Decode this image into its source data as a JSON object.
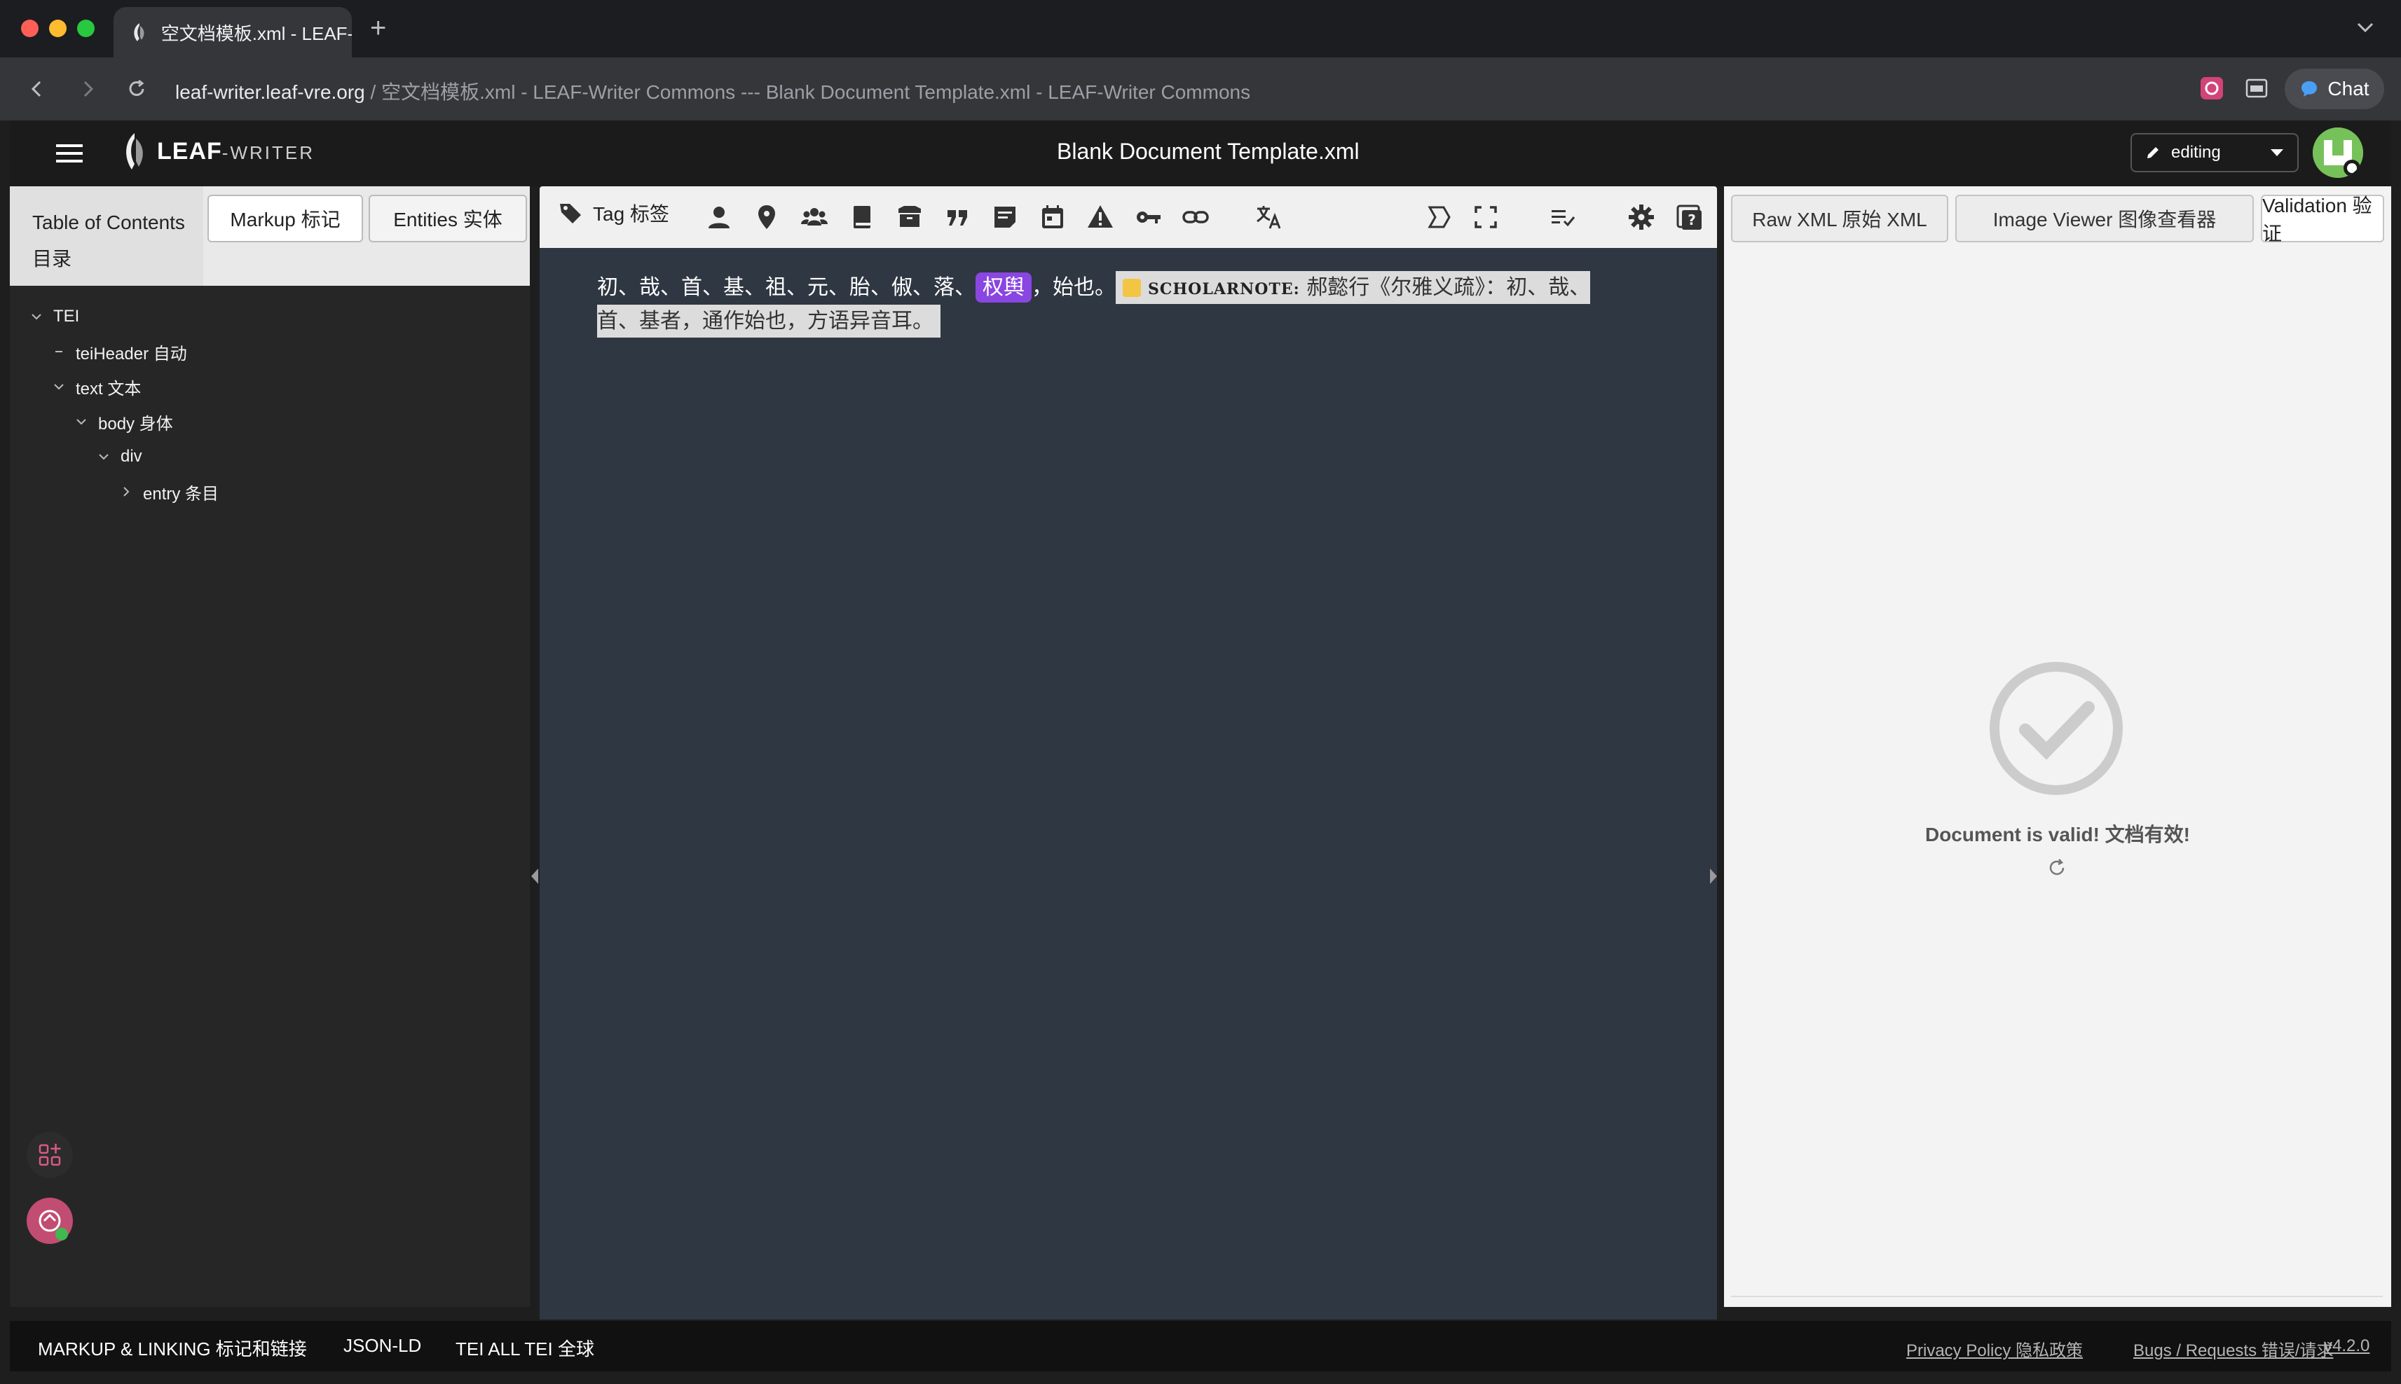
{
  "browser": {
    "tab_title": "空文档模板.xml - LEAF-",
    "new_tab": "+",
    "url_host": "leaf-writer.leaf-vre.org",
    "url_rest": " / 空文档模板.xml - LEAF-Writer Commons --- Blank Document Template.xml - LEAF-Writer Commons",
    "chat_label": "Chat"
  },
  "header": {
    "logo_main": "LEAF",
    "logo_sub": "-WRITER",
    "doc_title": "Blank Document Template.xml",
    "mode": "editing"
  },
  "left_panel": {
    "tabs": {
      "toc": "Table of Contents 目录",
      "markup": "Markup 标记",
      "entities": "Entities 实体"
    },
    "tree": [
      {
        "label": "TEI"
      },
      {
        "label": "teiHeader 自动"
      },
      {
        "label": "text 文本"
      },
      {
        "label": "body 身体"
      },
      {
        "label": "div"
      },
      {
        "label": "entry 条目"
      }
    ]
  },
  "toolbar": {
    "tag_label": "Tag 标签"
  },
  "editor": {
    "text_before": "初、哉、首、基、祖、元、胎、俶、落、",
    "entity": "权舆",
    "text_after": "，始也。",
    "note_label": "SCHOLARNOTE:",
    "note_text": " 郝懿行《尔雅义疏》：初、哉、首、基者，通作始也，方语异音耳。"
  },
  "right_panel": {
    "tabs": {
      "raw_xml": "Raw XML 原始 XML",
      "image_viewer": "Image Viewer 图像查看器",
      "validation": "Validation 验证"
    },
    "valid_message": "Document is valid! 文档有效!"
  },
  "footer": {
    "markup_linking": "MARKUP & LINKING 标记和链接",
    "json_ld": "JSON-LD",
    "tei_all": "TEI ALL TEI 全球",
    "privacy": "Privacy Policy 隐私政策",
    "bugs": "Bugs / Requests 错误/请求",
    "version": "v4.2.0"
  },
  "colors": {
    "entity_highlight": "#8a46e0",
    "valid_check": "#cccccc",
    "editor_bg": "#2f3742"
  }
}
